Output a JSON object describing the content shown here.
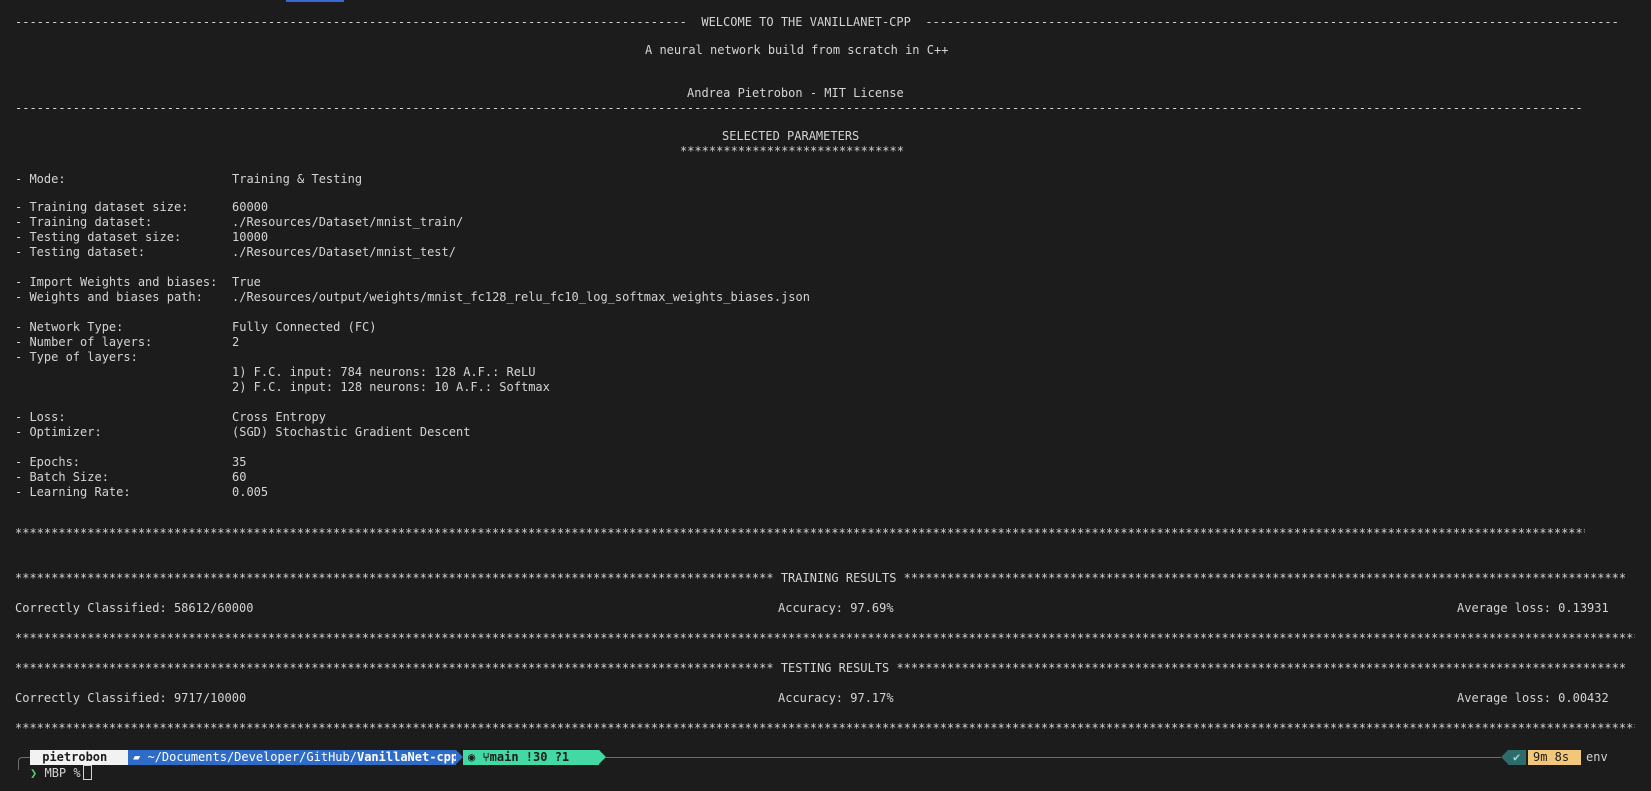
{
  "header": {
    "rule_left": "---------------------------------------------------------------------------------------------",
    "welcome": "WELCOME TO THE VANILLANET-CPP",
    "rule_right": "------------------------------------------------------------------------------------------------",
    "subtitle": "A neural network build from scratch in C++",
    "author": "Andrea Pietrobon - MIT License",
    "rule_full": "------------------------------------------------------------------------------------------------------------------------------------------------------------------------------------------------------------------------------------------------"
  },
  "params": {
    "title": "SELECTED PARAMETERS",
    "underline": "*******************************",
    "rows": [
      {
        "label": "- Mode:",
        "value": "Training & Testing"
      },
      {
        "label": "- Training dataset size:",
        "value": "60000"
      },
      {
        "label": "- Training dataset:",
        "value": "./Resources/Dataset/mnist_train/"
      },
      {
        "label": "- Testing dataset size:",
        "value": "10000"
      },
      {
        "label": "- Testing dataset:",
        "value": "./Resources/Dataset/mnist_test/"
      },
      {
        "label": "- Import Weights and biases:",
        "value": "True"
      },
      {
        "label": "- Weights and biases path:",
        "value": "./Resources/output/weights/mnist_fc128_relu_fc10_log_softmax_weights_biases.json"
      },
      {
        "label": "- Network Type:",
        "value": "Fully Connected (FC)"
      },
      {
        "label": "- Number of layers:",
        "value": "2"
      },
      {
        "label": "- Type of layers:",
        "value": ""
      },
      {
        "label": "",
        "value": "1) F.C. input: 784 neurons: 128 A.F.: ReLU"
      },
      {
        "label": "",
        "value": "2) F.C. input: 128 neurons: 10 A.F.: Softmax"
      },
      {
        "label": "- Loss:",
        "value": "Cross Entropy"
      },
      {
        "label": "- Optimizer:",
        "value": "(SGD) Stochastic Gradient Descent"
      },
      {
        "label": "- Epochs:",
        "value": "35"
      },
      {
        "label": "- Batch Size:",
        "value": "60"
      },
      {
        "label": "- Learning Rate:",
        "value": "0.005"
      }
    ]
  },
  "stars_full": "*****************************************************************************************************************************************************************************************************************************************************************",
  "stars_half_left": "*********************************************************************************************************",
  "stars_half_right": "*********************************************************************************************************",
  "training": {
    "title": "TRAINING RESULTS",
    "correct": "Correctly Classified: 58612/60000",
    "accuracy": "Accuracy: 97.69%",
    "loss": "Average loss: 0.13931"
  },
  "testing": {
    "title": "TESTING RESULTS",
    "correct": "Correctly Classified: 9717/10000",
    "accuracy": "Accuracy: 97.17%",
    "loss": "Average loss: 0.00432"
  },
  "prompt": {
    "user": "pietrobon",
    "path_prefix": "~/Documents/Developer/GitHub/",
    "path_repo": "VanillaNet-cpp",
    "branch": "main !30 ?1",
    "status_check": "✔",
    "duration": "9m 8s",
    "env": "env",
    "host": "MBP %",
    "arrow": "❯",
    "colors": {
      "user_bg": "#f2f2f2",
      "path_bg": "#2e6cc7",
      "git_bg": "#43d9a5",
      "check_bg": "#2f6b6b",
      "duration_bg": "#f2c77a",
      "prompt_arrow": "#4fd16b"
    }
  }
}
